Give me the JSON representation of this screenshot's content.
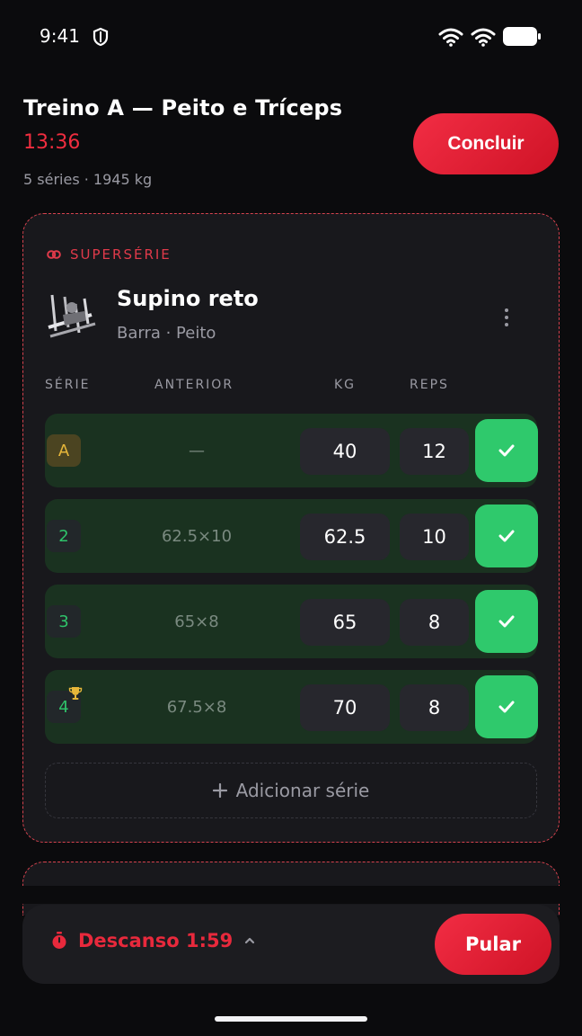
{
  "status_bar": {
    "time": "9:41"
  },
  "header": {
    "title": "Treino A — Peito e Tríceps",
    "timer": "13:36",
    "summary": "5 séries · 1945 kg",
    "finish_label": "Concluir"
  },
  "exercise": {
    "group_label": "SUPERSÉRIE",
    "name": "Supino reto",
    "subtitle": "Barra · Peito",
    "columns": {
      "set": "SÉRIE",
      "previous": "ANTERIOR",
      "kg": "KG",
      "reps": "REPS"
    },
    "sets": [
      {
        "label": "A",
        "type": "warmup",
        "previous": "—",
        "kg": "40",
        "reps": "12",
        "done": true
      },
      {
        "label": "2",
        "type": "normal",
        "previous": "62.5×10",
        "kg": "62.5",
        "reps": "10",
        "done": true
      },
      {
        "label": "3",
        "type": "normal",
        "previous": "65×8",
        "kg": "65",
        "reps": "8",
        "done": true
      },
      {
        "label": "4",
        "type": "record",
        "previous": "67.5×8",
        "kg": "70",
        "reps": "8",
        "done": true
      }
    ],
    "add_set_label": "Adicionar série"
  },
  "rest": {
    "label": "Descanso 1:59",
    "skip_label": "Pular"
  },
  "colors": {
    "accent": "#ef2d3f",
    "done": "#2fc96c",
    "row_done": "#1a3220",
    "warmup": "#e6b63a"
  }
}
